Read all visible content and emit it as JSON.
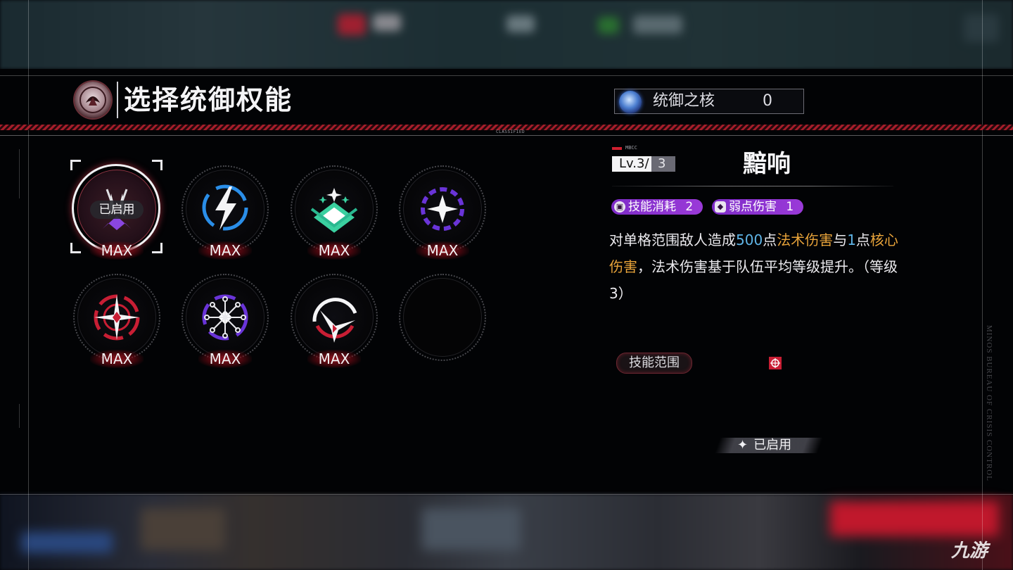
{
  "header": {
    "title": "选择统御权能",
    "emblem_icon": "bureau-emblem-icon",
    "core": {
      "label": "统御之核",
      "value": "0",
      "icon": "core-crystal-icon"
    }
  },
  "banner": {
    "classified": "CLASSIFIED"
  },
  "side_text": "MINOS BUREAU OF CRISIS CONTROL",
  "slots": [
    {
      "icon": "crown-sigil-icon",
      "level_label": "MAX",
      "selected": true,
      "enabled_tag": "已启用"
    },
    {
      "icon": "lightning-icon",
      "level_label": "MAX"
    },
    {
      "icon": "diamond-stars-icon",
      "level_label": "MAX"
    },
    {
      "icon": "purple-star-burst-icon",
      "level_label": "MAX"
    },
    {
      "icon": "red-crosshair-star-icon",
      "level_label": "MAX"
    },
    {
      "icon": "purple-node-icon",
      "level_label": "MAX"
    },
    {
      "icon": "red-arc-star-icon",
      "level_label": "MAX"
    },
    {
      "icon": "empty-slot",
      "level_label": ""
    }
  ],
  "detail": {
    "tag": "MBCC",
    "level_prefix": "Lv.3/",
    "level_max": "3",
    "name": "黯响",
    "pills": [
      {
        "icon": "cost-icon",
        "label": "技能消耗",
        "value": "2"
      },
      {
        "icon": "weakness-icon",
        "label": "弱点伤害",
        "value": "1"
      }
    ],
    "desc": {
      "p1": "对单格范围敌人造成",
      "v1": "500",
      "p2": "点",
      "h1": "法术伤害",
      "p3": "与",
      "v2": "1",
      "p4": "点",
      "h2": "核心伤害",
      "p5": "，法术伤害基于队伍平均等级提升。（等级3）"
    },
    "range_label": "技能范围",
    "range_icon": "single-target-icon",
    "enabled_label": "已启用",
    "enabled_icon": "sparkle-icon"
  },
  "watermark": "九游",
  "colors": {
    "accent_red": "#c81e34",
    "pill_purple": "#8a34d0",
    "highlight_blue": "#5fb4e6",
    "highlight_orange": "#e9a43a"
  }
}
